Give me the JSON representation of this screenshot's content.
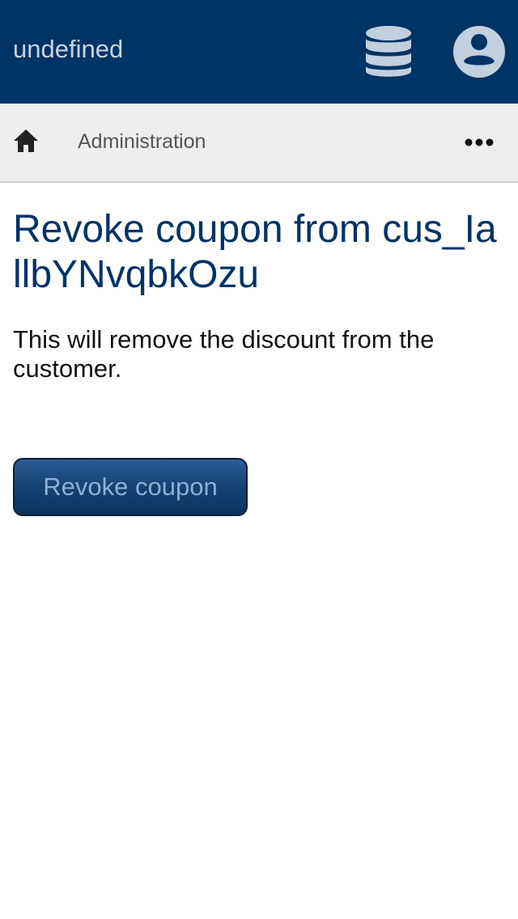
{
  "header": {
    "title": "undefined",
    "database_icon": "database-icon",
    "account_icon": "account-circle-icon",
    "bg_color": "#003366"
  },
  "breadcrumb": {
    "home_icon": "home-icon",
    "current": "Administration",
    "more_icon": "more-horizontal-icon"
  },
  "main": {
    "title": "Revoke coupon from cus_IallbYNvqbkOzu",
    "description": "This will remove the discount from the customer.",
    "revoke_button_label": "Revoke coupon"
  }
}
